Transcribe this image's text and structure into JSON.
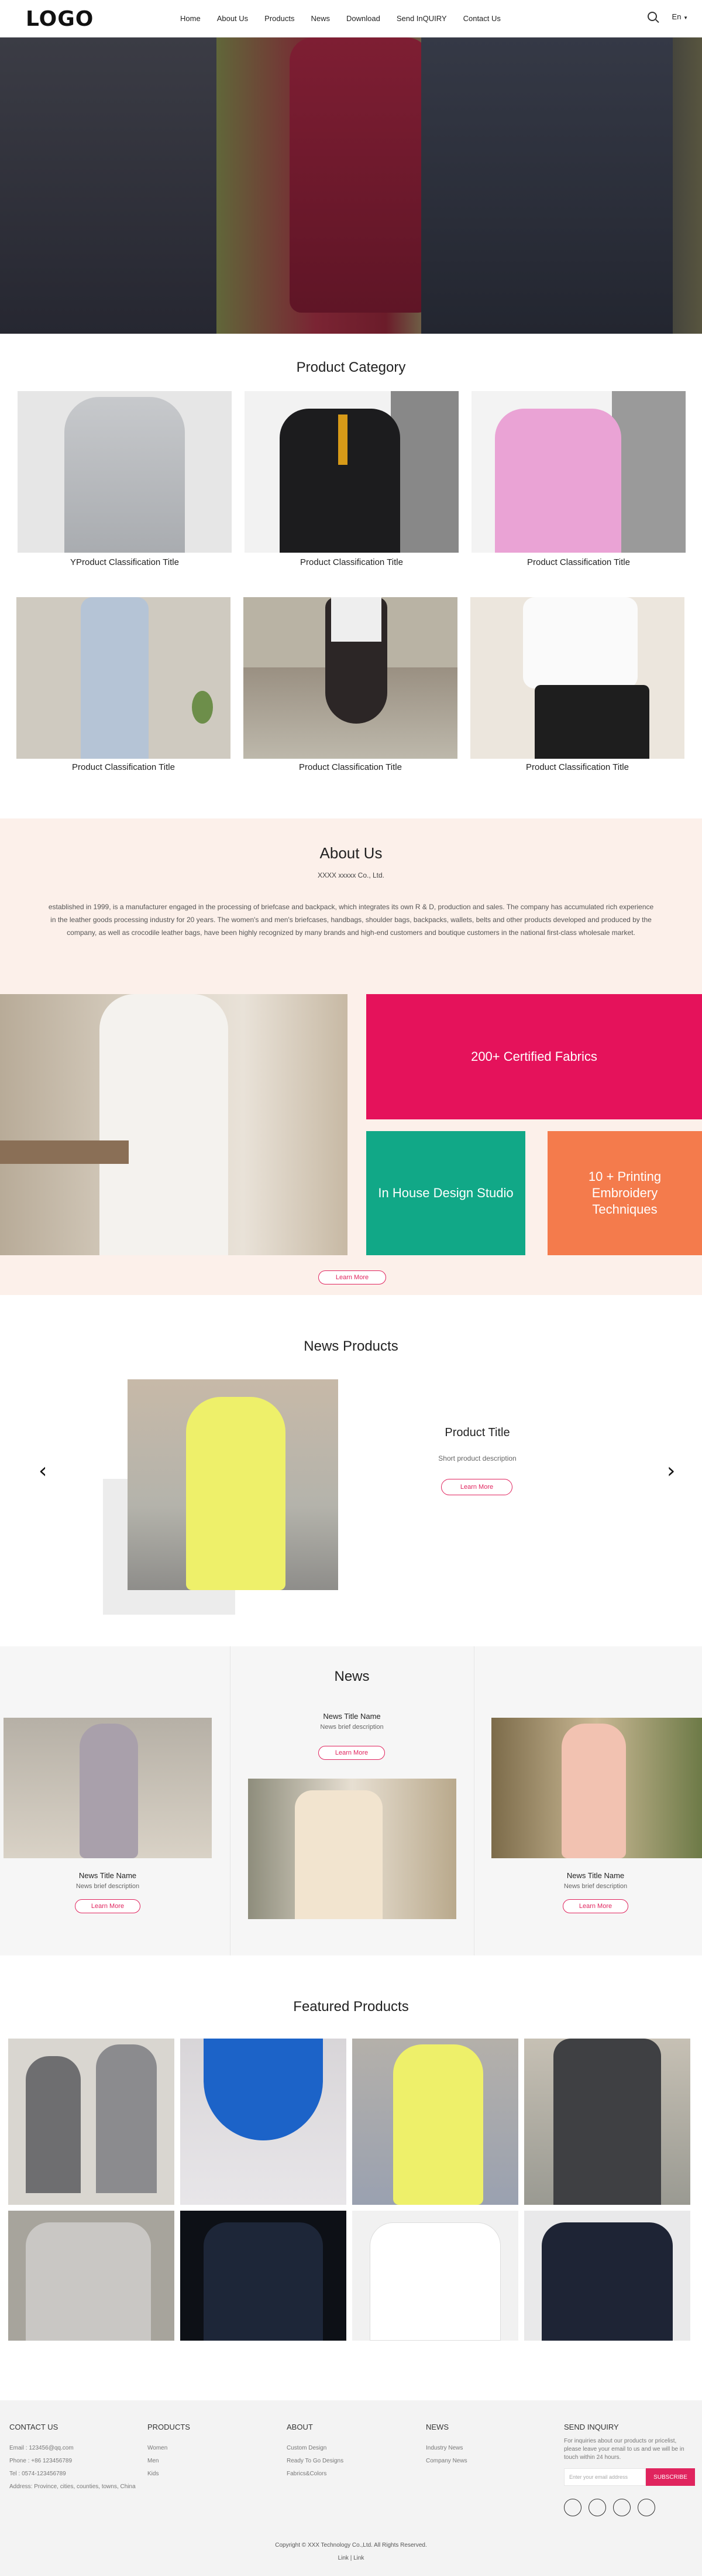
{
  "header": {
    "logo": "LOGO",
    "nav": [
      "Home",
      "About Us",
      "Products",
      "News",
      "Download",
      "Send InQUIRY",
      "Contact Us"
    ],
    "language": "En"
  },
  "category": {
    "title": "Product Category",
    "items": [
      "YProduct Classification Title",
      "Product Classification Title",
      "Product Classification Title",
      "Product Classification Title",
      "Product Classification Title",
      "Product Classification Title"
    ]
  },
  "about": {
    "title": "About Us",
    "company": "XXXX xxxxx Co., Ltd.",
    "text": "established in 1999, is a manufacturer engaged in the processing of briefcase and backpack, which integrates its own R & D, production and sales. The company has accumulated rich experience in the leather goods processing industry for 20 years. The women's and men's briefcases, handbags, shoulder bags, backpacks, wallets, belts and other products developed and produced by the company, as well as crocodile leather bags, have been highly recognized by many brands and high-end customers and boutique customers in the national first-class wholesale market.",
    "tiles": [
      "200+ Certified Fabrics",
      "In House Design Studio",
      "10 + Printing Embroidery Techniques"
    ],
    "learn_more": "Learn More",
    "colors": {
      "pink": "#e5125b",
      "green": "#11a887",
      "orange": "#f47b4c"
    }
  },
  "news_products": {
    "title": "News Products",
    "product_title": "Product Title",
    "description": "Short product description",
    "learn_more": "Learn More"
  },
  "news": {
    "title": "News",
    "items": [
      {
        "name": "News Title Name",
        "description": "News brief description",
        "button": "Learn More"
      },
      {
        "name": "News Title Name",
        "description": "News brief description",
        "button": "Learn More"
      },
      {
        "name": "News Title Name",
        "description": "News brief description",
        "button": "Learn More"
      }
    ]
  },
  "featured": {
    "title": "Featured Products"
  },
  "footer": {
    "contact": {
      "heading": "CONTACT US",
      "items": [
        "Email : 123456@qq.com",
        "Phone : +86 123456789",
        "Tel : 0574-123456789",
        "Address: Province, cities, counties, towns, China"
      ]
    },
    "products": {
      "heading": "PRODUCTS",
      "items": [
        "Women",
        "Men",
        "Kids"
      ]
    },
    "about": {
      "heading": "ABOUT",
      "items": [
        "Custom Design",
        "Ready To Go Designs",
        "Fabrics&Colors"
      ]
    },
    "news": {
      "heading": "NEWS",
      "items": [
        "Industry News",
        "Company News"
      ]
    },
    "inquiry": {
      "heading": "SEND INQUIRY",
      "text": "For inquiries about our products or pricelist, please leave your email to us and we will be in touch within 24 hours.",
      "placeholder": "Enter your email address",
      "button": "SUBSCRIBE"
    },
    "copyright": "Copyright © XXX Technology Co.,Ltd. All Rights Reserved.",
    "links": [
      "Link",
      "Link"
    ]
  }
}
